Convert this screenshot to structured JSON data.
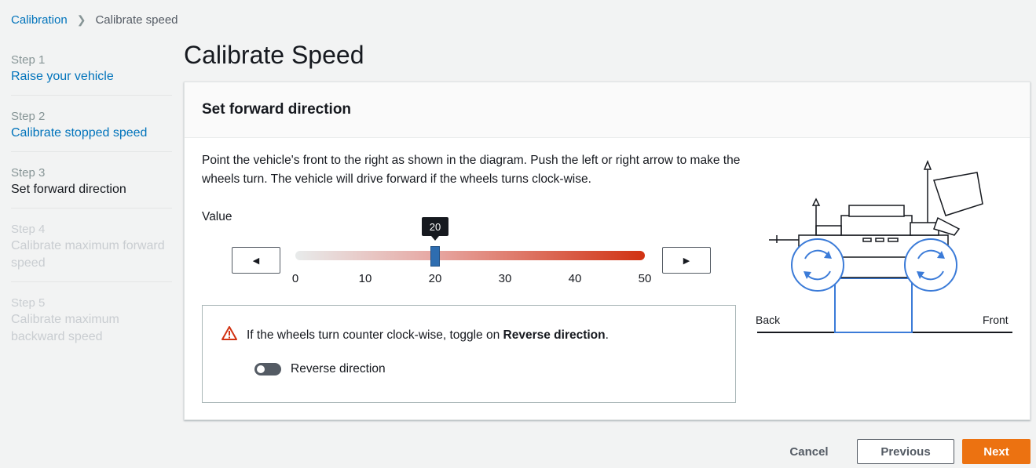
{
  "breadcrumb": {
    "root": "Calibration",
    "current": "Calibrate speed"
  },
  "steps": [
    {
      "number": "Step 1",
      "title": "Raise your vehicle",
      "state": "done"
    },
    {
      "number": "Step 2",
      "title": "Calibrate stopped speed",
      "state": "done"
    },
    {
      "number": "Step 3",
      "title": "Set forward direction",
      "state": "active"
    },
    {
      "number": "Step 4",
      "title": "Calibrate maximum forward speed",
      "state": "disabled"
    },
    {
      "number": "Step 5",
      "title": "Calibrate maximum backward speed",
      "state": "disabled"
    }
  ],
  "page_title": "Calibrate Speed",
  "panel": {
    "header": "Set forward direction",
    "description": "Point the vehicle's front to the right as shown in the diagram. Push the left or right arrow to make the wheels turn. The vehicle will drive forward if the wheels turns clock-wise.",
    "value_label": "Value",
    "slider": {
      "min": 0,
      "max": 50,
      "value": 20,
      "value_text": "20",
      "ticks": [
        "0",
        "10",
        "20",
        "30",
        "40",
        "50"
      ]
    },
    "alert": {
      "text_before": "If the wheels turn counter clock-wise, toggle on ",
      "text_bold": "Reverse direction",
      "text_after": "."
    },
    "toggle": {
      "label": "Reverse direction",
      "on": false
    },
    "diagram": {
      "back_label": "Back",
      "front_label": "Front"
    }
  },
  "footer": {
    "cancel": "Cancel",
    "previous": "Previous",
    "next": "Next"
  },
  "colors": {
    "link": "#0073bb",
    "primary": "#ec7211",
    "slider_end": "#d13212",
    "thumb": "#2e6db0",
    "wheel": "#3b7bd8"
  }
}
